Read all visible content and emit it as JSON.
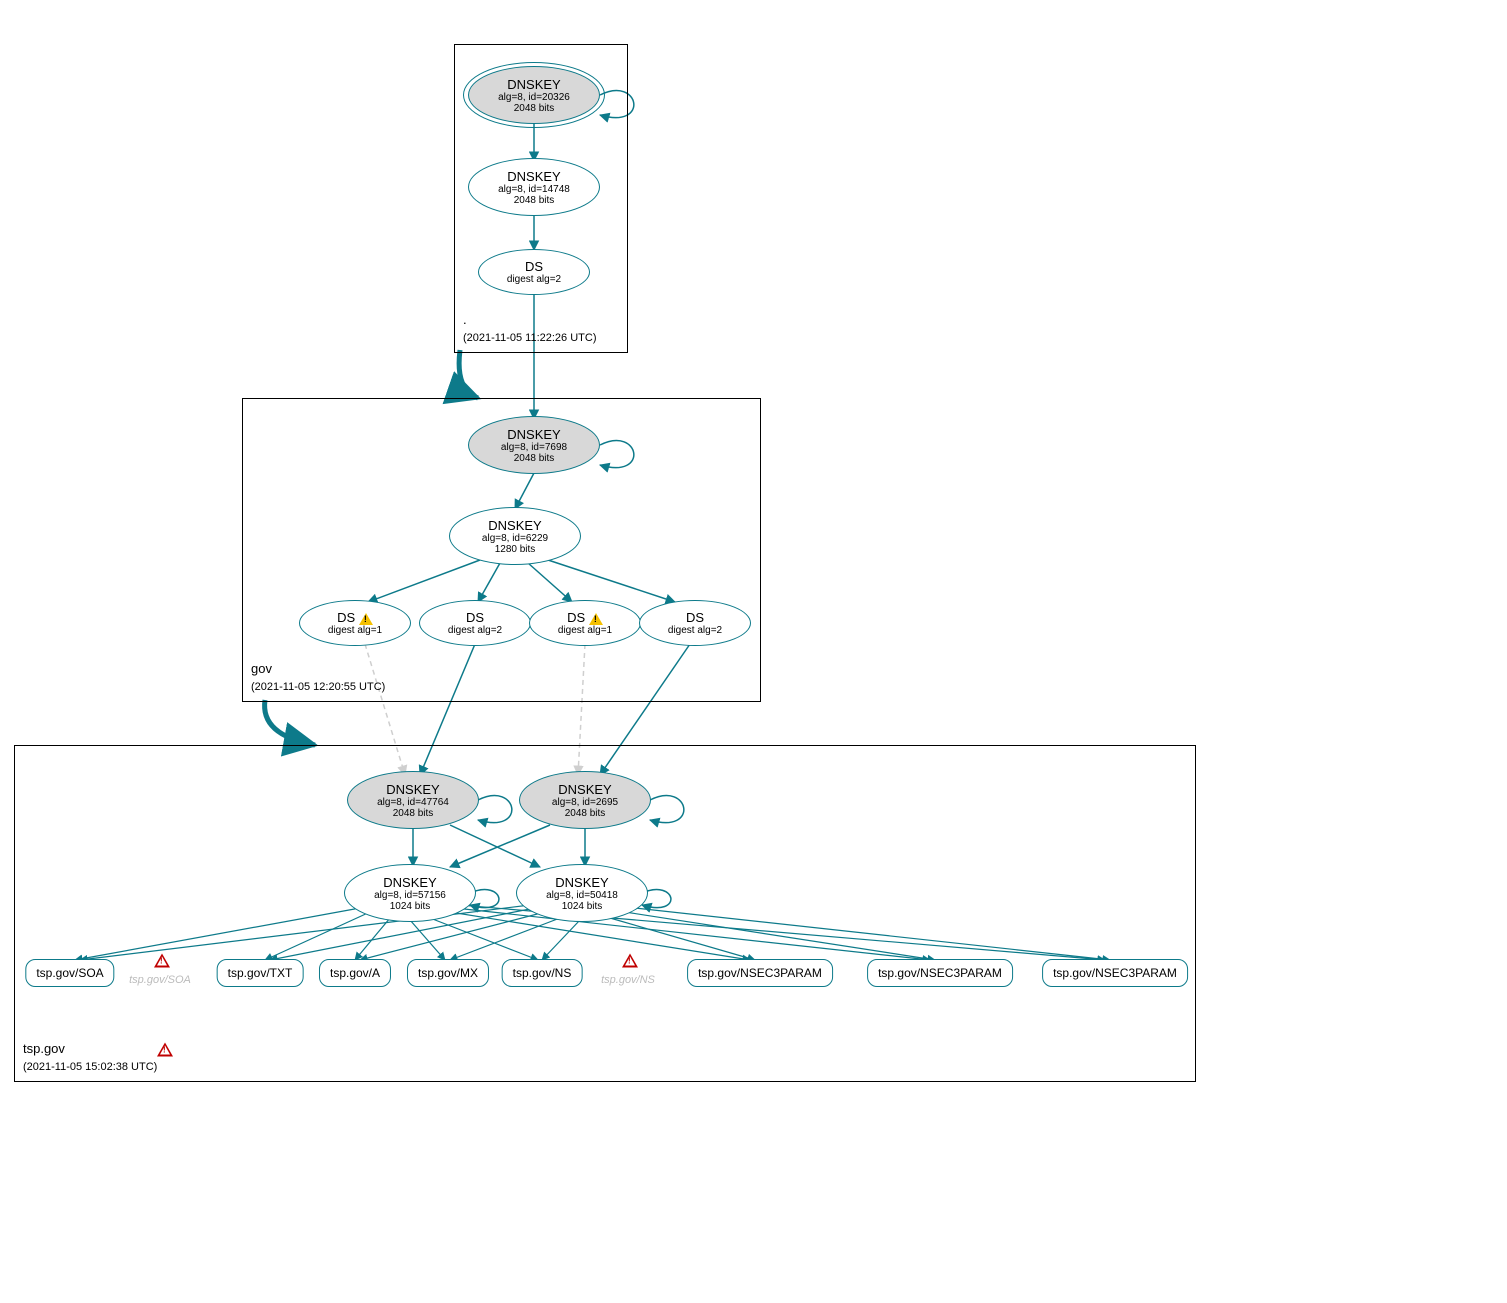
{
  "colors": {
    "stroke": "#0d7a8a",
    "faint": "#cfcfcf"
  },
  "zones": {
    "root": {
      "name": ".",
      "timestamp": "(2021-11-05 11:22:26 UTC)"
    },
    "gov": {
      "name": "gov",
      "timestamp": "(2021-11-05 12:20:55 UTC)"
    },
    "tspgov": {
      "name": "tsp.gov",
      "timestamp": "(2021-11-05 15:02:38 UTC)"
    }
  },
  "nodes": {
    "root_ksk": {
      "title": "DNSKEY",
      "line2": "alg=8, id=20326",
      "line3": "2048 bits"
    },
    "root_zsk": {
      "title": "DNSKEY",
      "line2": "alg=8, id=14748",
      "line3": "2048 bits"
    },
    "root_ds": {
      "title": "DS",
      "line2": "digest alg=2"
    },
    "gov_ksk": {
      "title": "DNSKEY",
      "line2": "alg=8, id=7698",
      "line3": "2048 bits"
    },
    "gov_zsk": {
      "title": "DNSKEY",
      "line2": "alg=8, id=6229",
      "line3": "1280 bits"
    },
    "gov_ds1": {
      "title": "DS",
      "line2": "digest alg=1",
      "warn": true
    },
    "gov_ds2": {
      "title": "DS",
      "line2": "digest alg=2"
    },
    "gov_ds3": {
      "title": "DS",
      "line2": "digest alg=1",
      "warn": true
    },
    "gov_ds4": {
      "title": "DS",
      "line2": "digest alg=2"
    },
    "tsp_ksk1": {
      "title": "DNSKEY",
      "line2": "alg=8, id=47764",
      "line3": "2048 bits"
    },
    "tsp_ksk2": {
      "title": "DNSKEY",
      "line2": "alg=8, id=2695",
      "line3": "2048 bits"
    },
    "tsp_zsk1": {
      "title": "DNSKEY",
      "line2": "alg=8, id=57156",
      "line3": "1024 bits"
    },
    "tsp_zsk2": {
      "title": "DNSKEY",
      "line2": "alg=8, id=50418",
      "line3": "1024 bits"
    }
  },
  "rrsets": {
    "soa": "tsp.gov/SOA",
    "txt": "tsp.gov/TXT",
    "a": "tsp.gov/A",
    "mx": "tsp.gov/MX",
    "ns": "tsp.gov/NS",
    "np1": "tsp.gov/NSEC3PARAM",
    "np2": "tsp.gov/NSEC3PARAM",
    "np3": "tsp.gov/NSEC3PARAM"
  },
  "ghosts": {
    "soa": "tsp.gov/SOA",
    "ns": "tsp.gov/NS"
  }
}
